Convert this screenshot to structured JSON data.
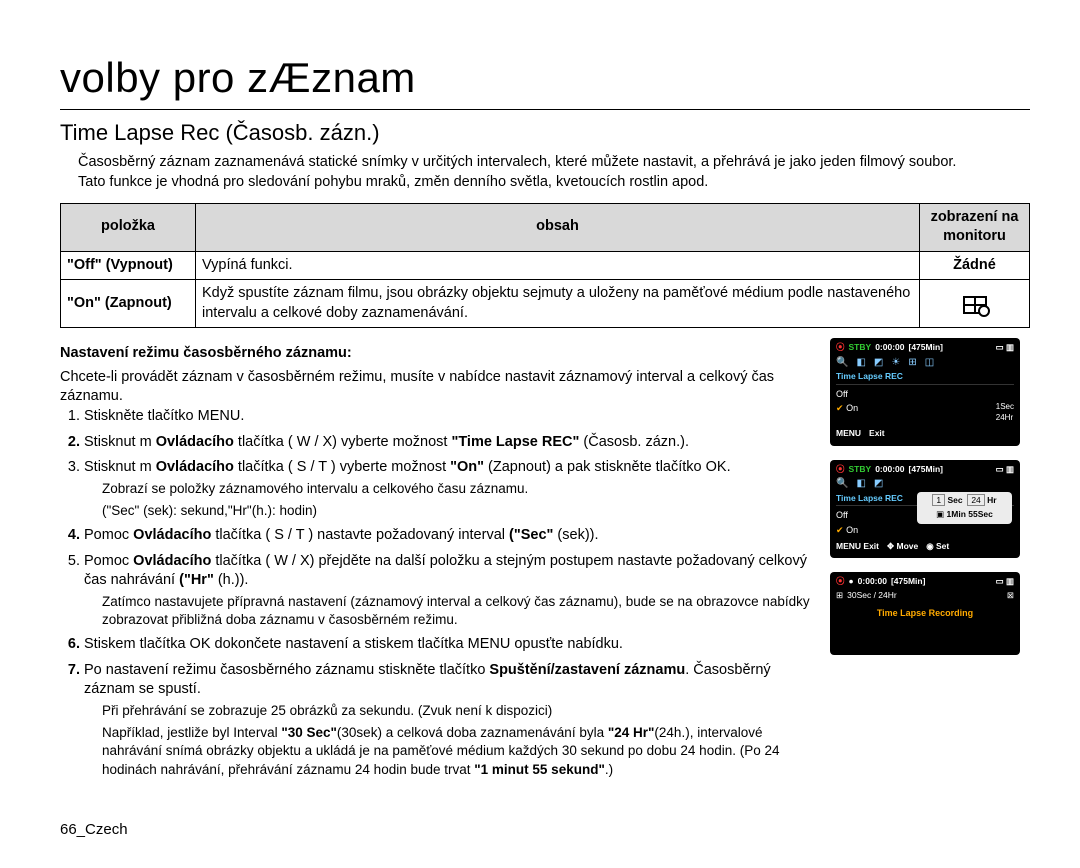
{
  "title": "volby pro zÆznam",
  "subtitle": "Time Lapse Rec (Časosb. zázn.)",
  "intro1": "Časosběrný záznam zaznamenává statické snímky v určitých intervalech, které můžete nastavit, a přehrává je jako jeden filmový soubor.",
  "intro2": "Tato funkce je vhodná pro sledování pohybu mraků, změn denního světla, kvetoucích rostlin apod.",
  "table": {
    "head": {
      "c1": "položka",
      "c2": "obsah",
      "c3": "zobrazení na monitoru"
    },
    "rows": [
      {
        "c1": "\"Off\" (Vypnout)",
        "c2": "Vypíná funkci.",
        "c3": "Žádné"
      },
      {
        "c1": "\"On\" (Zapnout)",
        "c2": "Když spustíte záznam filmu, jsou obrázky objektu sejmuty a uloženy na paměťové médium podle nastaveného intervalu a celkové doby zaznamenávání.",
        "c3": "icon"
      }
    ]
  },
  "subhead": "Nastavení režimu časosběrného záznamu:",
  "lead": "Chcete-li provádět záznam v časosběrném režimu, musíte v nabídce nastavit záznamový interval a celkový čas záznamu.",
  "steps": {
    "s1": "Stiskněte tlačítko MENU.",
    "s2a": "Stisknut m ",
    "s2b": "Ovládacího",
    "s2c": " tlačítka ( W /  X) vyberte možnost ",
    "s2d": "\"Time Lapse REC\"",
    "s2e": " (Časosb. zázn.).",
    "s3a": "Stisknut m ",
    "s3b": "Ovládacího",
    "s3c": " tlačítka (  S / T ) vyberte možnost ",
    "s3d": "\"On\"",
    "s3e": " (Zapnout) a pak stiskněte tlačítko OK.",
    "s3note1": "Zobrazí se položky záznamového intervalu a celkového času záznamu.",
    "s3note2": "(\"Sec\" (sek): sekund,\"Hr\"(h.): hodin)",
    "s4a": "Pomoc ",
    "s4b": "Ovládacího",
    "s4c": " tlačítka (  S / T ) nastavte požadovaný interval ",
    "s4d": "(\"Sec\"",
    "s4e": " (sek)).",
    "s5a": "Pomoc ",
    "s5b": "Ovládacího",
    "s5c": " tlačítka ( W /  X) přejděte na další položku a stejným postupem nastavte požadovaný celkový čas nahrávání ",
    "s5d": "(\"Hr\"",
    "s5e": " (h.)).",
    "s5note": "Zatímco nastavujete přípravná nastavení (záznamový interval a celkový čas záznamu), bude se na obrazovce nabídky zobrazovat přibližná doba záznamu v časosběrném režimu.",
    "s6": "Stiskem tlačítka OK dokončete nastavení a stiskem tlačítka MENU opusťte nabídku.",
    "s7a": "Po nastavení režimu časosběrného záznamu stiskněte tlačítko ",
    "s7b": "Spuštění/zastavení záznamu",
    "s7c": ". Časosběrný záznam se spustí.",
    "s7n1": "Při přehrávání se zobrazuje 25 obrázků za sekundu. (Zvuk není k dispozici)",
    "s7n2a": "Například, jestliže byl Interval ",
    "s7n2b": "\"30 Sec\"",
    "s7n2c": "(30sek) a celková doba zaznamenávání byla ",
    "s7n2d": "\"24 Hr\"",
    "s7n2e": "(24h.), intervalové nahrávání snímá obrázky objektu a ukládá je na paměťové médium každých 30 sekund po dobu 24 hodin. (Po 24 hodinách nahrávání, přehrávání záznamu 24 hodin bude trvat ",
    "s7n2f": "\"1 minut 55 sekund\"",
    "s7n2g": ".)"
  },
  "lcd": {
    "stby": "STBY",
    "time": "0:00:00",
    "remain": "[475Min]",
    "menuTitle": "Time Lapse REC",
    "off": "Off",
    "on": "On",
    "side1": "1Sec",
    "side2": "24Hr",
    "menu": "MENU",
    "exit": "Exit",
    "move": "Move",
    "set": "Set",
    "popupSec": "Sec",
    "popupHr": "Hr",
    "popupLine2": "1Min 55Sec",
    "popupBoxSec": "1",
    "popupBoxHr": "24",
    "thirdInterval": "30Sec / 24Hr",
    "thirdTitle": "Time Lapse Recording"
  },
  "footer": "66_Czech"
}
